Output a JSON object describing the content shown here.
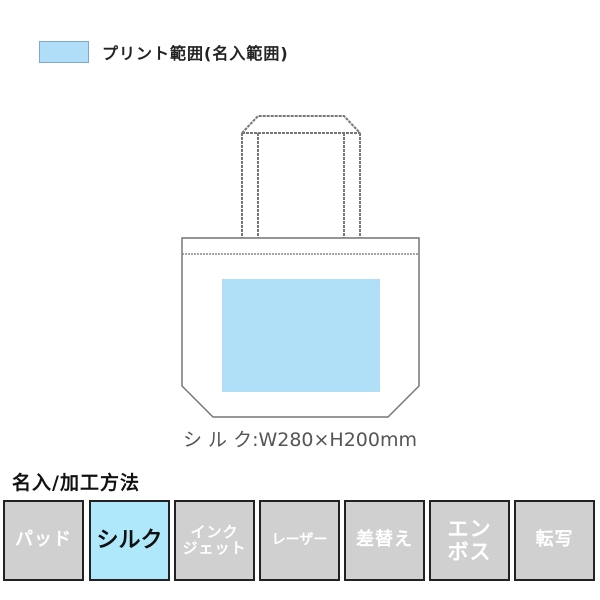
{
  "legend": {
    "label": "プリント範囲(名入範囲)",
    "swatch_color": "#b0def8"
  },
  "product": {
    "dimensions": "シ ル ク:W280×H200mm",
    "print_area_color": "#b0e0f8",
    "outline_color": "#777777"
  },
  "methods": {
    "title": "名入/加工方法",
    "items": [
      {
        "label": "パッド",
        "active": false
      },
      {
        "label": "シルク",
        "active": true
      },
      {
        "label": "インク\nジェット",
        "active": false
      },
      {
        "label": "レーザー",
        "active": false
      },
      {
        "label": "差替え",
        "active": false
      },
      {
        "label": "エン\nボス",
        "active": false
      },
      {
        "label": "転写",
        "active": false
      }
    ],
    "active_color": "#aee8fa",
    "inactive_color": "#d0d0d0"
  }
}
